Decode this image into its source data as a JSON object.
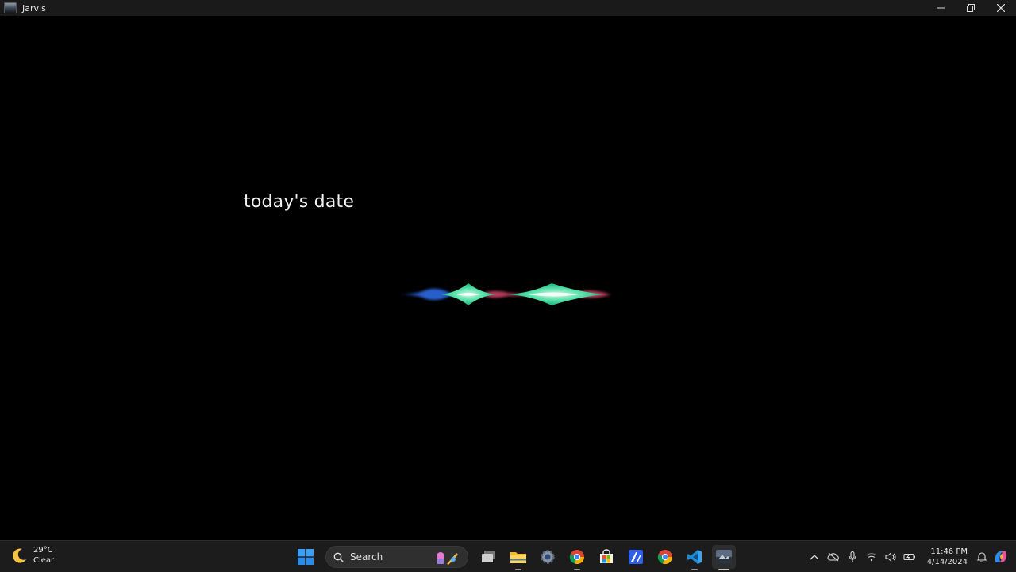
{
  "window": {
    "title": "Jarvis",
    "controls": {
      "minimize": "─",
      "restore": "❐",
      "close": "✕"
    }
  },
  "main": {
    "transcript": "today's date",
    "waveform": {
      "colors": [
        "#2f6fe0",
        "#2ee8a0",
        "#e04a6a",
        "#ffffff"
      ]
    }
  },
  "taskbar": {
    "weather": {
      "temp": "29°C",
      "condition": "Clear",
      "icon": "moon-icon"
    },
    "search": {
      "label": "Search"
    },
    "apps": [
      {
        "name": "start-button",
        "icon": "windows-logo-icon"
      },
      {
        "name": "task-view-button",
        "icon": "task-view-icon"
      },
      {
        "name": "file-explorer",
        "icon": "folder-icon"
      },
      {
        "name": "settings",
        "icon": "gear-icon"
      },
      {
        "name": "chrome",
        "icon": "chrome-icon"
      },
      {
        "name": "microsoft-store",
        "icon": "store-icon"
      },
      {
        "name": "app-blue",
        "icon": "app-icon"
      },
      {
        "name": "chrome-profile",
        "icon": "chrome-icon"
      },
      {
        "name": "vs-code",
        "icon": "vscode-icon"
      },
      {
        "name": "jarvis",
        "icon": "jarvis-icon"
      }
    ],
    "tray": {
      "clock_time": "11:46 PM",
      "clock_date": "4/14/2024"
    }
  }
}
